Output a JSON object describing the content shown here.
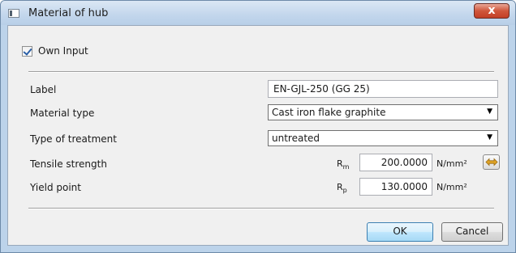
{
  "window": {
    "title": "Material of hub",
    "close_label": "x"
  },
  "own_input": {
    "label": "Own Input",
    "checked": true
  },
  "fields": {
    "label": {
      "label": "Label",
      "value": "EN-GJL-250 (GG 25)"
    },
    "material_type": {
      "label": "Material type",
      "value": "Cast iron flake graphite"
    },
    "treatment": {
      "label": "Type of treatment",
      "value": "untreated"
    },
    "tensile": {
      "label": "Tensile strength",
      "symbol": "Rm",
      "value": "200.0000",
      "unit": "N/mm²"
    },
    "yield": {
      "label": "Yield point",
      "symbol": "Rp",
      "value": "130.0000",
      "unit": "N/mm²"
    }
  },
  "buttons": {
    "ok": "OK",
    "cancel": "Cancel"
  },
  "icons": {
    "window": "window-icon",
    "close": "close-icon",
    "dropdown": "chevron-down-icon",
    "convert": "convert-arrows-icon"
  },
  "colors": {
    "titlebar": "#c2d6ec",
    "client": "#f0f0f0",
    "close": "#c23f26",
    "convert_icon": "#e0a425"
  }
}
